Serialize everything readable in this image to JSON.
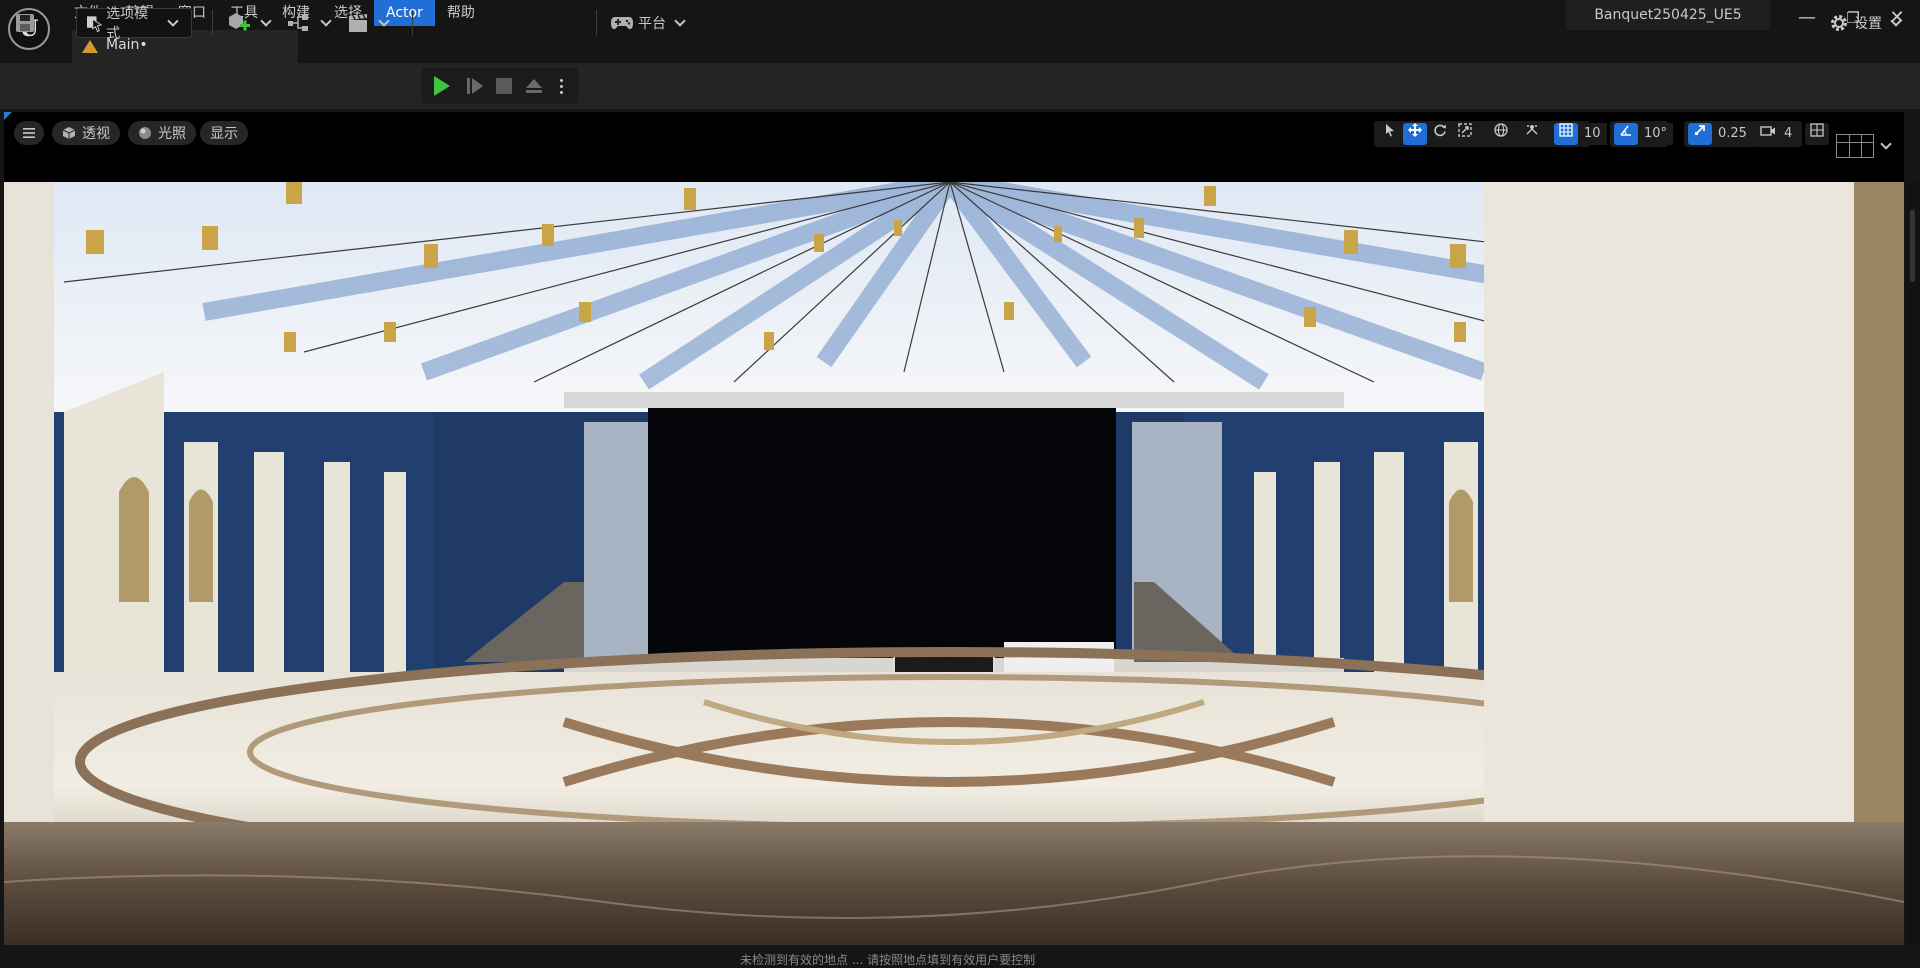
{
  "app": {
    "project_name": "Banquet250425_UE5",
    "logo_glyph": "U"
  },
  "menu": {
    "items": [
      {
        "label": "文件"
      },
      {
        "label": "编辑"
      },
      {
        "label": "窗口"
      },
      {
        "label": "工具"
      },
      {
        "label": "构建"
      },
      {
        "label": "选择"
      },
      {
        "label": "Actor",
        "active": true
      },
      {
        "label": "帮助"
      }
    ]
  },
  "window_controls": {
    "minimize": "—",
    "maximize": "❐",
    "close": "✕"
  },
  "tabs": [
    {
      "label": "Main•"
    }
  ],
  "toolbar": {
    "mode_label": "选项模式",
    "platform_label": "平台",
    "settings_label": "设置"
  },
  "viewport": {
    "perspective_label": "透视",
    "lighting_label": "光照",
    "show_label": "显示",
    "grid_snap": "10",
    "rotation_snap": "10°",
    "scale_snap": "0.25",
    "camera_speed": "4"
  },
  "status": {
    "text": "未检测到有效的地点 ... 请按照地点填到有效用户要控制"
  },
  "colors": {
    "accent": "#1f6fd6",
    "play": "#3ec43e",
    "background": "#151515",
    "toolbar": "#242424"
  }
}
